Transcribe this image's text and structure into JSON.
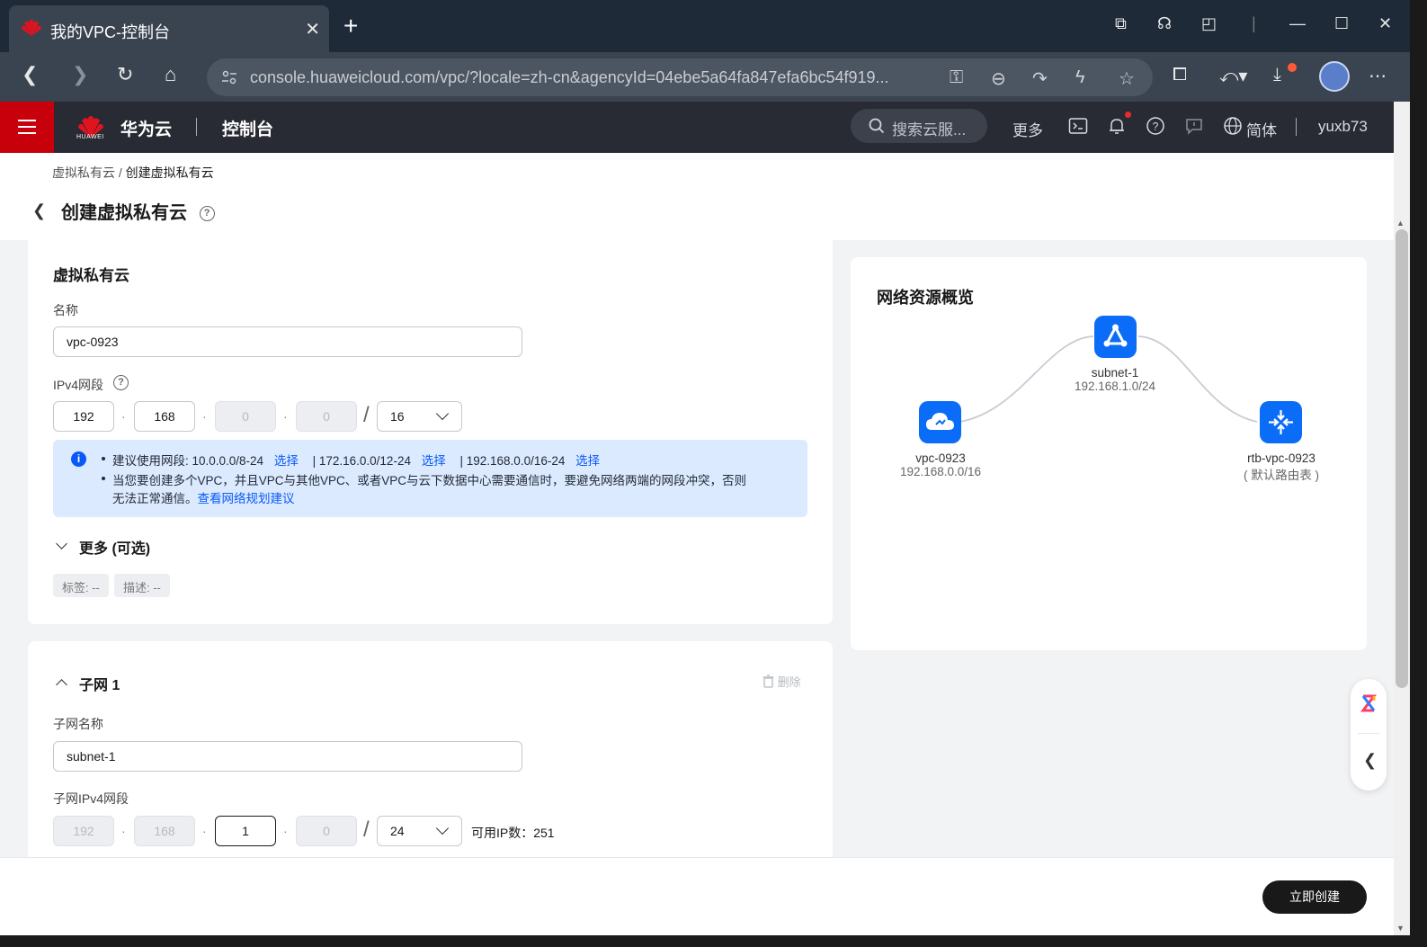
{
  "browser": {
    "tab_title": "我的VPC-控制台",
    "url": "console.huaweicloud.com/vpc/?locale=zh-cn&agencyId=04ebe5a64fa847efa6bc54f919..."
  },
  "header": {
    "brand": "华为云",
    "logo_text": "HUAWEI",
    "console": "控制台",
    "search_placeholder": "搜索云服...",
    "more": "更多",
    "language": "简体",
    "user": "yuxb73"
  },
  "page": {
    "breadcrumb_parent": "虚拟私有云",
    "breadcrumb_sep": " / ",
    "breadcrumb_current": "创建虚拟私有云",
    "title": "创建虚拟私有云",
    "help_glyph": "?"
  },
  "vpc": {
    "section_title": "虚拟私有云",
    "name_label": "名称",
    "name_value": "vpc-0923",
    "ipv4_label": "IPv4网段",
    "octets": [
      "192",
      "168",
      "0",
      "0"
    ],
    "mask": "16",
    "info": {
      "icon_glyph": "i",
      "line1_prefix": "建议使用网段: 10.0.0.0/8-24",
      "select": "选择",
      "line1_mid1": "|  172.16.0.0/12-24",
      "line1_mid2": "|  192.168.0.0/16-24",
      "line2": "当您要创建多个VPC，并且VPC与其他VPC、或者VPC与云下数据中心需要通信时，要避免网络两端的网段冲突，否则",
      "line3_prefix": "无法正常通信。",
      "line3_link": "查看网络规划建议"
    },
    "more_label": "更多 (可选)",
    "tag_chip": "标签: --",
    "desc_chip": "描述: --"
  },
  "subnet": {
    "section_title": "子网 1",
    "delete_label": "删除",
    "name_label": "子网名称",
    "name_value": "subnet-1",
    "ipv4_label": "子网IPv4网段",
    "octets": [
      "192",
      "168",
      "1",
      "0"
    ],
    "mask": "24",
    "available_ips": "可用IP数：251"
  },
  "overview": {
    "title": "网络资源概览",
    "vpc_name": "vpc-0923",
    "vpc_cidr": "192.168.0.0/16",
    "subnet_name": "subnet-1",
    "subnet_cidr": "192.168.1.0/24",
    "rtb_name": "rtb-vpc-0923",
    "rtb_note": "( 默认路由表 )"
  },
  "footer": {
    "create_button": "立即创建"
  },
  "colors": {
    "brand_red": "#c7000b",
    "accent_blue": "#0a59f7",
    "node_blue": "#0a6cf7",
    "header_dark": "#282b33"
  }
}
